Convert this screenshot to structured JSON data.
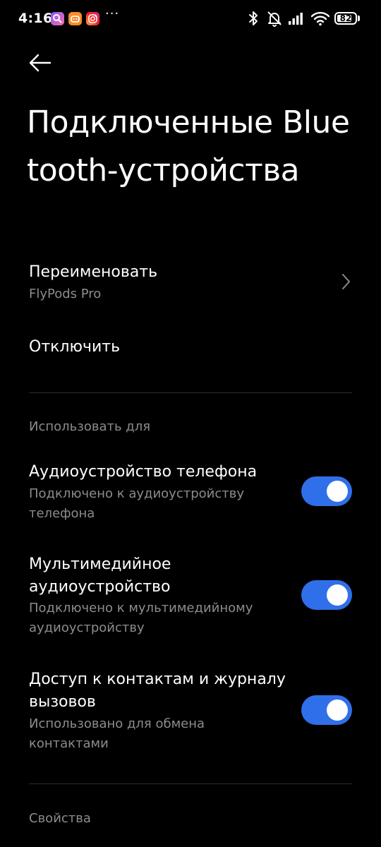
{
  "status_bar": {
    "time": "4:16",
    "more": "···",
    "battery": "82",
    "battery_level": 0.82,
    "icons": [
      "app-notification-icon",
      "app-notification-icon",
      "instagram-icon",
      "bluetooth-icon",
      "mute-icon",
      "signal-icon",
      "wifi-icon",
      "battery-icon"
    ]
  },
  "header": {
    "back_icon": "arrow-left-icon",
    "title": "Подключенные Bluetooth-устройства"
  },
  "rename": {
    "label": "Переименовать",
    "value": "FlyPods Pro"
  },
  "disconnect": {
    "label": "Отключить"
  },
  "use_for": {
    "header": "Использовать для",
    "items": [
      {
        "title": "Аудиоустройство телефона",
        "subtitle": "Подключено к аудиоустройству телефона",
        "enabled": true
      },
      {
        "title": "Мультимедийное аудиоустройство",
        "subtitle": "Подключено к мультимедийному аудиоустройству",
        "enabled": true
      },
      {
        "title": "Доступ к контактам и журналу вызовов",
        "subtitle": "Использовано для обмена контактами",
        "enabled": true
      }
    ]
  },
  "properties": {
    "header": "Свойства"
  },
  "colors": {
    "background": "#000000",
    "text_primary": "#ffffff",
    "text_secondary": "#8c8c8c",
    "accent": "#2f6fe9",
    "divider": "#2c2c2c"
  }
}
